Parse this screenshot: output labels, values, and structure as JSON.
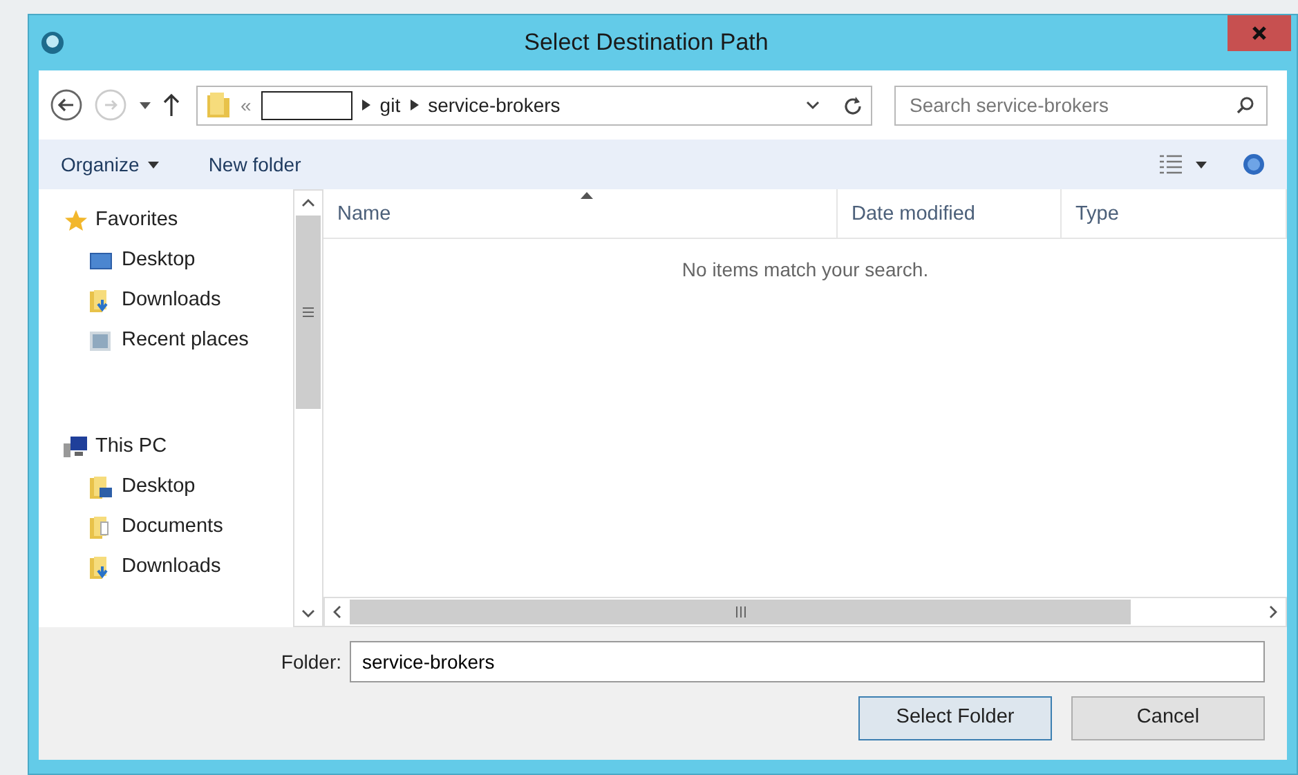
{
  "window": {
    "title": "Select Destination Path"
  },
  "address": {
    "crumbs": [
      {
        "kind": "overflow",
        "label": "«"
      },
      {
        "kind": "redacted"
      },
      {
        "kind": "segment",
        "label": "git"
      },
      {
        "kind": "segment",
        "label": "service-brokers"
      }
    ]
  },
  "search": {
    "placeholder": "Search service-brokers"
  },
  "toolbar": [
    {
      "label": "Organize",
      "dropdown": true
    },
    {
      "label": "New folder",
      "dropdown": false
    }
  ],
  "sidebar": [
    {
      "label": "Favorites",
      "kind": "star",
      "children": [
        {
          "label": "Desktop",
          "kind": "desktop"
        },
        {
          "label": "Downloads",
          "kind": "downloads"
        },
        {
          "label": "Recent places",
          "kind": "recent"
        }
      ]
    },
    {
      "label": "This PC",
      "kind": "pc",
      "children": [
        {
          "label": "Desktop",
          "kind": "folder-desktop"
        },
        {
          "label": "Documents",
          "kind": "documents"
        },
        {
          "label": "Downloads",
          "kind": "downloads"
        }
      ]
    }
  ],
  "file_list": {
    "columns": [
      {
        "label": "Name",
        "sorted": true
      },
      {
        "label": "Date modified",
        "sorted": false
      },
      {
        "label": "Type",
        "sorted": false
      }
    ],
    "empty_message": "No items match your search."
  },
  "folder_field": {
    "label": "Folder:",
    "value": "service-brokers"
  },
  "buttons": [
    {
      "label": "Select Folder",
      "default": true
    },
    {
      "label": "Cancel",
      "default": false
    }
  ]
}
